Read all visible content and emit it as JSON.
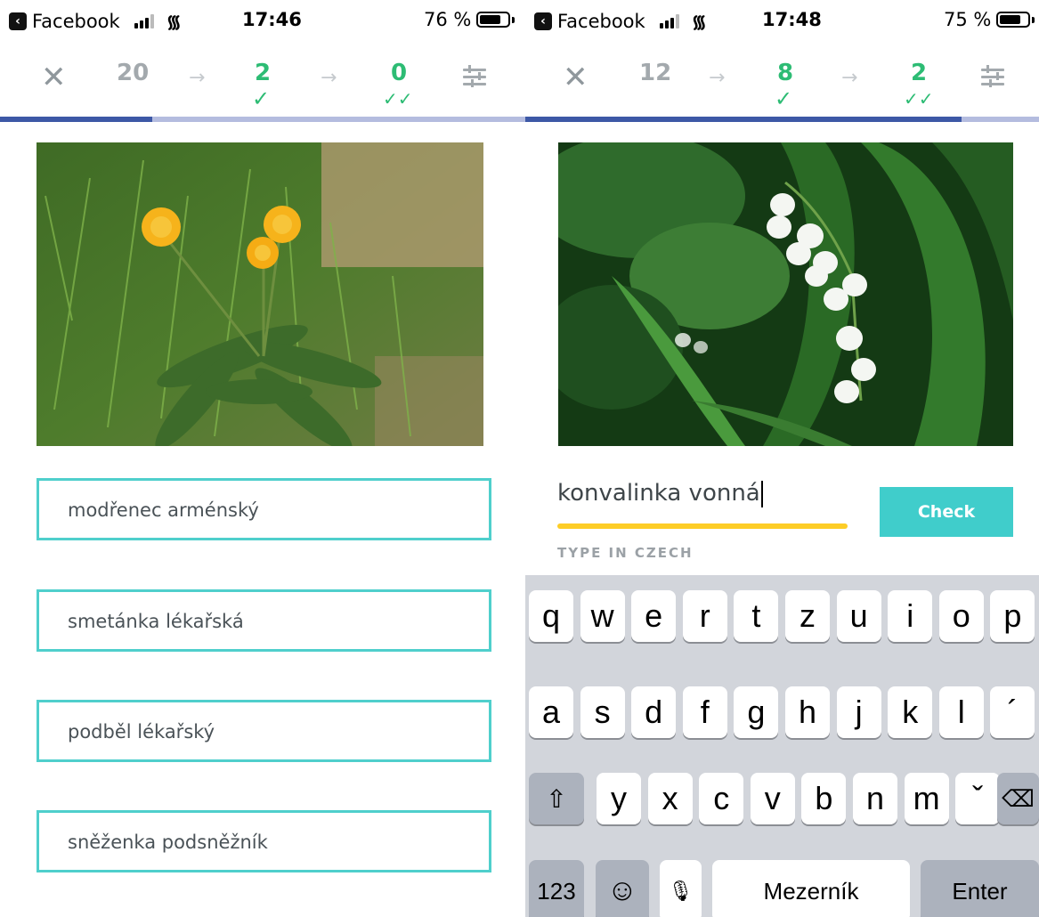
{
  "screens": [
    {
      "status": {
        "back_app": "Facebook",
        "time": "17:46",
        "battery": "76 %",
        "battery_level": 0.76
      },
      "header": {
        "close_icon": "close-icon",
        "learning_count": "20",
        "known_count": "2",
        "mastered_count": "0",
        "settings_icon": "sliders-icon"
      },
      "progress": {
        "fraction": 0.29
      },
      "image": {
        "icon": "dandelion-photo"
      },
      "options": [
        {
          "label": "modřenec arménský"
        },
        {
          "label": "smetánka lékařská"
        },
        {
          "label": "podběl lékařský"
        },
        {
          "label": "sněženka podsněžník"
        }
      ]
    },
    {
      "status": {
        "back_app": "Facebook",
        "time": "17:48",
        "battery": "75 %",
        "battery_level": 0.75
      },
      "header": {
        "close_icon": "close-icon",
        "learning_count": "12",
        "known_count": "8",
        "mastered_count": "2",
        "settings_icon": "sliders-icon"
      },
      "progress": {
        "fraction": 0.85
      },
      "image": {
        "icon": "lily-of-the-valley-photo"
      },
      "input": {
        "value": "konvalinka vonná",
        "hint": "TYPE IN CZECH"
      },
      "check_label": "Check",
      "keyboard": {
        "row1": [
          "q",
          "w",
          "e",
          "r",
          "t",
          "z",
          "u",
          "i",
          "o",
          "p"
        ],
        "row2": [
          "a",
          "s",
          "d",
          "f",
          "g",
          "h",
          "j",
          "k",
          "l",
          "´"
        ],
        "row3": [
          "y",
          "x",
          "c",
          "v",
          "b",
          "n",
          "m",
          "ˇ"
        ],
        "shift_icon": "shift-icon",
        "backspace_icon": "backspace-icon",
        "numbers": "123",
        "emoji_icon": "emoji-icon",
        "mic_icon": "microphone-icon",
        "space": "Mezerník",
        "enter": "Enter"
      }
    }
  ],
  "colors": {
    "accent_teal": "#4fcfcc",
    "check_teal": "#40cdcb",
    "green": "#2dbc74",
    "progress_fill": "#3d58a6",
    "progress_track": "#b4bcdf",
    "underline_yellow": "#fdcd27"
  }
}
